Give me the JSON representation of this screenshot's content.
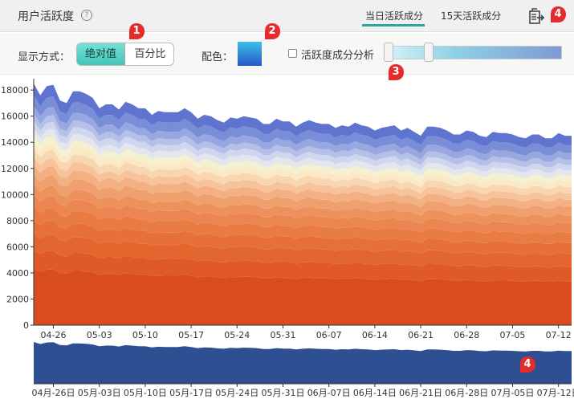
{
  "header": {
    "title": "用户活跃度",
    "help_glyph": "?",
    "tab_today": "当日活跃成分",
    "tab_15days": "15天活跃成分",
    "export_icon": "export-icon"
  },
  "toolbar": {
    "mode_label": "显示方式：",
    "mode_absolute": "绝对值",
    "mode_percent": "百分比",
    "selected_mode": "绝对值",
    "color_label": "配色：",
    "color_scheme": [
      "#3bc2e6",
      "#2a56c8"
    ],
    "analysis_checkbox_label": "活跃度成分分析",
    "analysis_checked": false
  },
  "markers": [
    {
      "number": "1",
      "color": "#e52b2b"
    },
    {
      "number": "2",
      "color": "#e52b2b"
    },
    {
      "number": "3",
      "color": "#e52b2b"
    },
    {
      "number": "4",
      "color": "#e52b2b"
    }
  ],
  "chart_data": {
    "type": "area",
    "stacked": true,
    "ylim": [
      0,
      18500
    ],
    "yticks": [
      0,
      2000,
      4000,
      6000,
      8000,
      10000,
      12000,
      14000,
      16000,
      18000
    ],
    "x_tick_labels": [
      "04-26",
      "05-03",
      "05-10",
      "05-17",
      "05-24",
      "05-31",
      "06-07",
      "06-14",
      "06-21",
      "06-28",
      "07-05",
      "07-12"
    ],
    "totals": [
      18500,
      17600,
      18300,
      18400,
      17200,
      17000,
      17900,
      17900,
      17700,
      17400,
      16600,
      16900,
      16900,
      16500,
      17100,
      16900,
      16600,
      16600,
      16100,
      16400,
      16300,
      16300,
      16300,
      16600,
      16300,
      15800,
      16100,
      16000,
      15700,
      15500,
      15900,
      15800,
      16000,
      15900,
      15800,
      15400,
      15400,
      15800,
      15600,
      15600,
      15200,
      15500,
      15700,
      15500,
      15400,
      15400,
      15100,
      15300,
      15200,
      15500,
      15300,
      15200,
      14900,
      15100,
      15200,
      15300,
      14900,
      15100,
      14800,
      14500,
      15200,
      15200,
      15100,
      14900,
      14600,
      14600,
      14900,
      14800,
      14500,
      14400,
      14800,
      14700,
      14700,
      14600,
      14400,
      14300,
      14600,
      14600,
      14300,
      14300,
      14700,
      14500,
      14500
    ],
    "layer_fractions": [
      0.24,
      0.08,
      0.07,
      0.06,
      0.055,
      0.05,
      0.045,
      0.045,
      0.04,
      0.035,
      0.035,
      0.03,
      0.03,
      0.03,
      0.03,
      0.03,
      0.035,
      0.045,
      0.05
    ],
    "layer_colors": [
      "#d84c1e",
      "#df5a27",
      "#e3662f",
      "#e67038",
      "#e97c43",
      "#ec8650",
      "#ee925d",
      "#f0a06f",
      "#f3b183",
      "#f6c39c",
      "#f9d6b2",
      "#fbe9c6",
      "#f5f0d0",
      "#e3e6ec",
      "#cfd6ee",
      "#b4c0e8",
      "#98a7e0",
      "#7a8ed8",
      "#5e74cf"
    ],
    "overview_color": "#2e5093",
    "overview_labels": [
      "04月-26日",
      "05月-03日",
      "05月-10日",
      "05月-17日",
      "05月-24日",
      "05月-31日",
      "06月-07日",
      "06月-14日",
      "06月-21日",
      "06月-28日",
      "07月-05日",
      "07月-12日"
    ]
  }
}
